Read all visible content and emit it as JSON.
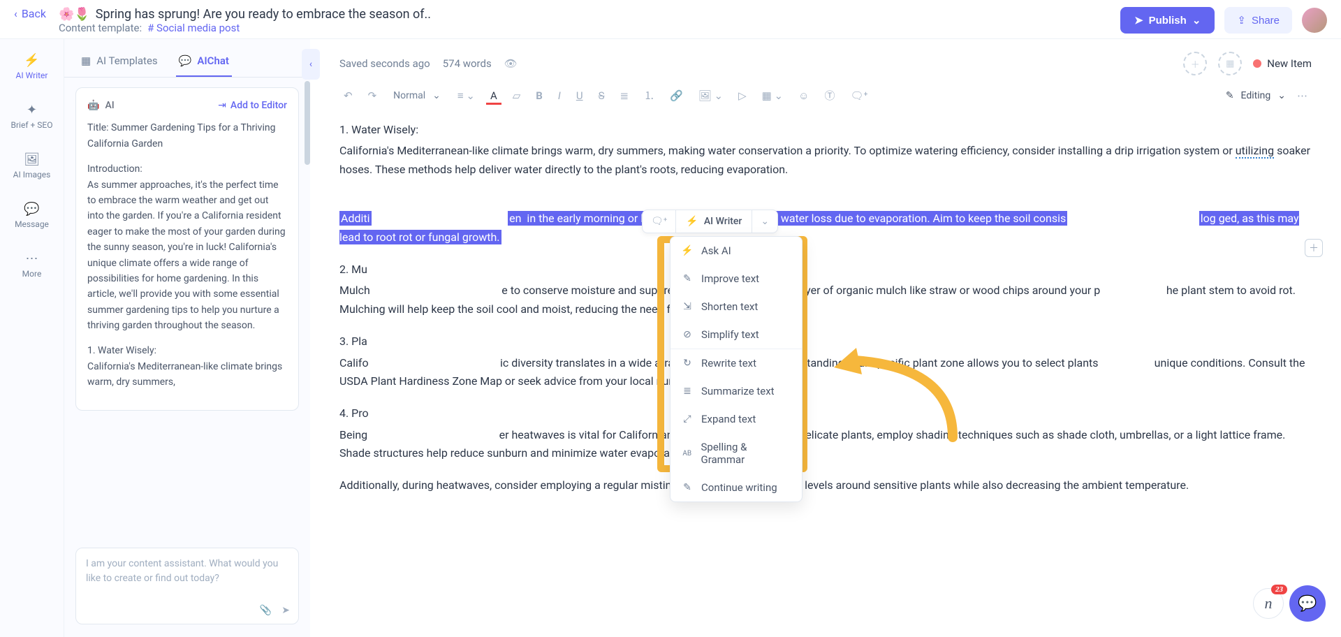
{
  "header": {
    "back": "Back",
    "title_emoji": "🌸🌷",
    "title": "Spring has sprung! Are you ready to embrace the season of..",
    "template_label": "Content template:",
    "template_value": "# Social media post",
    "publish": "Publish",
    "share": "Share"
  },
  "nav": {
    "items": [
      {
        "icon": "⚡",
        "label": "AI Writer",
        "active": true
      },
      {
        "icon": "✦",
        "label": "Brief + SEO"
      },
      {
        "icon": "🖼",
        "label": "AI Images"
      },
      {
        "icon": "💬",
        "label": "Message"
      },
      {
        "icon": "⋯",
        "label": "More"
      }
    ]
  },
  "panel": {
    "tabs": {
      "templates": "AI Templates",
      "chat": "AIChat"
    },
    "active_tab": "chat",
    "ai_label": "AI",
    "add_to_editor": "Add to Editor",
    "card_title": "Title: Summer Gardening Tips for a Thriving California Garden",
    "card_intro_label": "Introduction:",
    "card_intro": "As summer approaches, it's the perfect time to embrace the warm weather and get out into the garden. If you're a California resident eager to make the most of your garden during the sunny season, you're in luck! California's unique climate offers a wide range of possibilities for home gardening. In this article, we'll provide you with some essential summer gardening tips to help you nurture a thriving garden throughout the season.",
    "card_sec1_title": "1. Water Wisely:",
    "card_sec1_body": "California's Mediterranean-like climate brings warm, dry summers,",
    "input_placeholder": "I am your content assistant. What would you like to create or find out today?"
  },
  "editor_meta": {
    "saved": "Saved seconds ago",
    "word_count": "574 words",
    "new_item": "New Item"
  },
  "toolbar": {
    "style": "Normal",
    "editing": "Editing"
  },
  "doc": {
    "s1_title": "1. Water Wisely:",
    "s1_p1": "California's Mediterranean-like climate brings warm, dry summers, making water conservation a priority. To optimize watering efficiency, consider installing a drip irrigation system or ",
    "s1_utilizing": "utilizing",
    "s1_p1b": " soaker hoses. These methods help deliver water directly to the plant's roots, reducing evaporation.",
    "s1_sel_a": "Additi",
    "s1_sel_gap1": "en",
    "s1_sel_mid": " in the early morning or late evening helps minimize water loss due to evaporation. Aim to keep the soil consis",
    "s1_sel_gap2": "log",
    "s1_sel_end": "ged, as this may lead to root rot or fungal growth.",
    "s2_title": "2. Mu",
    "s2_p_a": "Mulch",
    "s2_p_b": "e to conserve moisture and suppress weed growth. Apply a layer of organic mulch like straw or wood chips around your p",
    "s2_p_c": "he plant stem to avoid rot. Mulching will help keep the soil cool and moist, reducing the need for excessive watering.",
    "s3_title": "3. Pla",
    "s3_p_a": "Califo",
    "s3_p_b": "ic diversity translates in    a wide array of microclimates. Understanding your specific plant zone allows you to select plants",
    "s3_p_c": "unique conditions. Consult the USDA Plant Hardiness Zone Map or seek advice from your local nursery for plants suitabl",
    "s4_title": "4. Pro",
    "s4_p_a": "Being",
    "s4_p_b": "er heatwaves is vital for Californian gardens. To protect your delicate plants, employ shading techniques such as shade cloth, umbrellas, or a light lattice frame. Shade structures help reduce sunburn and minimize water evaporation.",
    "s4_p2": "Additionally, during heatwaves, consider employing a regular misting system to raise humidity levels around sensitive plants while also decreasing the ambient temperature."
  },
  "ai_writer": {
    "label": "AI Writer",
    "menu": [
      {
        "icon": "⚡",
        "label": "Ask AI"
      },
      {
        "icon": "✎",
        "label": "Improve text"
      },
      {
        "icon": "⇲",
        "label": "Shorten text"
      },
      {
        "icon": "⊘",
        "label": "Simplify text"
      },
      {
        "icon": "↻",
        "label": "Rewrite text"
      },
      {
        "icon": "≣",
        "label": "Summarize text"
      },
      {
        "icon": "⤢",
        "label": "Expand text"
      },
      {
        "icon": "AB",
        "label": "Spelling & Grammar"
      },
      {
        "icon": "✎",
        "label": "Continue writing"
      }
    ]
  },
  "floating": {
    "badge": "23"
  }
}
